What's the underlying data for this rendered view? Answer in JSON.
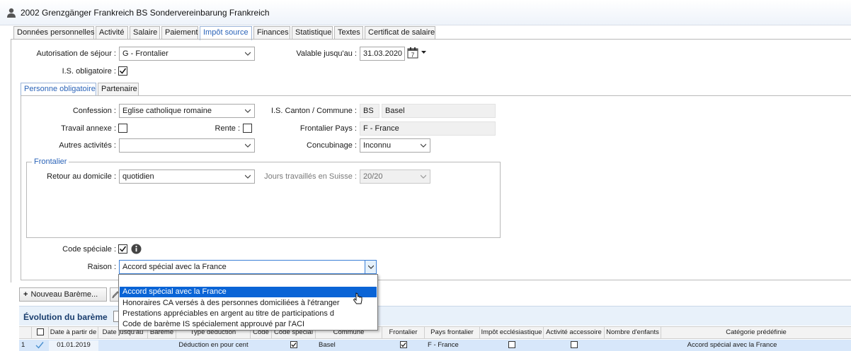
{
  "window": {
    "title": "2002 Grenzgänger Frankreich BS Sondervereinbarung Frankreich"
  },
  "tabs": [
    {
      "label": "Données personnelles",
      "active": false
    },
    {
      "label": "Activité",
      "active": false
    },
    {
      "label": "Salaire",
      "active": false
    },
    {
      "label": "Paiement",
      "active": false
    },
    {
      "label": "Impôt source",
      "active": true
    },
    {
      "label": "Finances",
      "active": false
    },
    {
      "label": "Statistique",
      "active": false
    },
    {
      "label": "Textes",
      "active": false
    },
    {
      "label": "Certificat de salaire",
      "active": false
    }
  ],
  "form": {
    "autorisation_label": "Autorisation de séjour :",
    "autorisation_value": "G - Frontalier",
    "valable_label": "Valable jusqu'au :",
    "valable_value": "31.03.2020",
    "is_obligatoire_label": "I.S. obligatoire :",
    "is_obligatoire_checked": true
  },
  "subtabs": [
    {
      "label": "Personne obligatoire",
      "active": true
    },
    {
      "label": "Partenaire",
      "active": false
    }
  ],
  "person": {
    "confession_label": "Confession :",
    "confession_value": "Eglise catholique romaine",
    "canton_label": "I.S. Canton / Commune :",
    "canton_value": "BS",
    "commune_value": "Basel",
    "travail_label": "Travail annexe :",
    "rente_label": "Rente :",
    "frontalier_pays_label": "Frontalier Pays :",
    "frontalier_pays_value": "F - France",
    "autres_label": "Autres activités :",
    "autres_value": "",
    "concubinage_label": "Concubinage :",
    "concubinage_value": "Inconnu"
  },
  "frontalier": {
    "legend": "Frontalier",
    "retour_label": "Retour au domicile :",
    "retour_value": "quotidien",
    "jours_label": "Jours travaillés en Suisse :",
    "jours_value": "20/20"
  },
  "code_special": {
    "label": "Code spéciale :",
    "checked": true,
    "raison_label": "Raison :",
    "raison_value": "Accord spécial avec la France"
  },
  "dropdown": {
    "items": [
      {
        "label": "",
        "selected": false
      },
      {
        "label": "Accord spécial avec la France",
        "selected": true
      },
      {
        "label": "Honoraires CA versés à des personnes domiciliées à l'étranger",
        "selected": false
      },
      {
        "label": "Prestations appréciables en argent au titre de participations d",
        "selected": false
      },
      {
        "label": "Code de barème IS spécialement approuvé par l'ACI",
        "selected": false
      }
    ]
  },
  "buttons": {
    "nouveau_bareme": "Nouveau Barème..."
  },
  "evolution": {
    "title": "Évolution du barème",
    "columns": [
      "Date à partir de",
      "Date jusqu'au",
      "Barème",
      "Type déduction",
      "Code",
      "Code spécial",
      "Commune",
      "Frontalier",
      "Pays frontalier",
      "Impôt ecclésiastique",
      "Activité accessoire",
      "Nombre d'enfants",
      "Catégorie prédéfinie"
    ],
    "row": {
      "index": "1",
      "date_from": "01.01.2019",
      "type_deduction": "Déduction en pour cent",
      "commune": "Basel",
      "pays_frontalier": "F - France",
      "categorie": "Accord spécial avec la France"
    }
  },
  "colors": {
    "accent": "#2a63b8",
    "selection": "#0a64d6"
  }
}
